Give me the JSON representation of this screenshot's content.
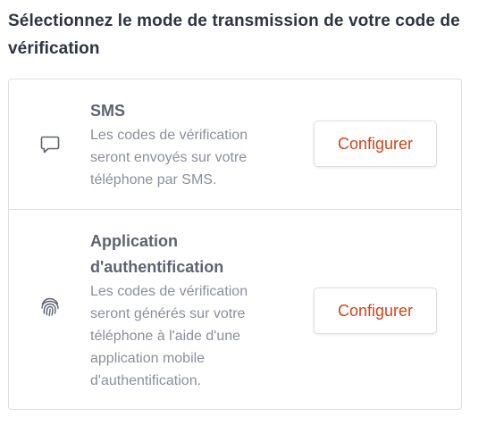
{
  "heading": "Sélectionnez le mode de transmission de votre code de vérification",
  "colors": {
    "accent": "#d4431b",
    "heading": "#2f3440",
    "title": "#5e6271",
    "description": "#8b8f9b",
    "border": "#dcdee3"
  },
  "options": [
    {
      "icon": "chat-bubble-icon",
      "title": "SMS",
      "description": "Les codes de vérification seront envoyés sur votre téléphone par SMS.",
      "button_label": "Configurer"
    },
    {
      "icon": "fingerprint-icon",
      "title": "Application d'authentification",
      "description": "Les codes de vérification seront générés sur votre téléphone à l'aide d'une application mobile d'authentification.",
      "button_label": "Configurer"
    }
  ]
}
